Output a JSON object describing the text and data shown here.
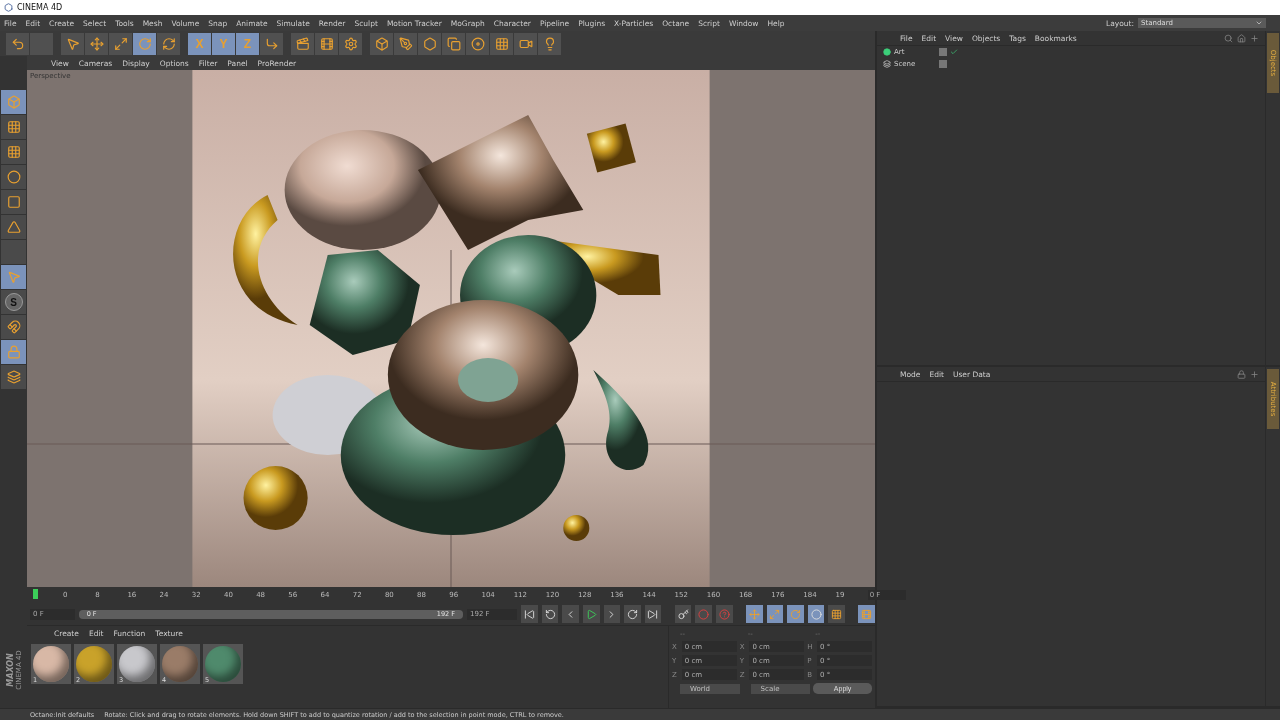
{
  "window": {
    "title": "CINEMA 4D"
  },
  "menu": [
    "File",
    "Edit",
    "Create",
    "Select",
    "Tools",
    "Mesh",
    "Volume",
    "Snap",
    "Animate",
    "Simulate",
    "Render",
    "Sculpt",
    "Motion Tracker",
    "MoGraph",
    "Character",
    "Pipeline",
    "Plugins",
    "X-Particles",
    "Octane",
    "Script",
    "Window",
    "Help"
  ],
  "layout": {
    "label": "Layout:",
    "value": "Standard"
  },
  "toolbar": [
    {
      "kind": "undo",
      "selected": false
    },
    {
      "kind": "blank",
      "selected": false
    },
    {
      "kind": "select",
      "selected": false
    },
    {
      "kind": "move",
      "selected": false
    },
    {
      "kind": "scale",
      "selected": false
    },
    {
      "kind": "rotate",
      "selected": true
    },
    {
      "kind": "recent",
      "selected": false
    },
    {
      "kind": "axis",
      "label": "X",
      "selected": true
    },
    {
      "kind": "axis",
      "label": "Y",
      "selected": true
    },
    {
      "kind": "axis",
      "label": "Z",
      "selected": true
    },
    {
      "kind": "coords",
      "selected": false
    },
    {
      "kind": "render-view",
      "selected": false
    },
    {
      "kind": "render",
      "selected": false
    },
    {
      "kind": "render-settings",
      "selected": false
    },
    {
      "kind": "cube",
      "selected": false
    },
    {
      "kind": "pen",
      "selected": false
    },
    {
      "kind": "subdivision",
      "selected": false
    },
    {
      "kind": "cloner",
      "selected": false
    },
    {
      "kind": "deformer",
      "selected": false
    },
    {
      "kind": "floor",
      "selected": false
    },
    {
      "kind": "camera",
      "selected": false
    },
    {
      "kind": "light",
      "selected": false
    }
  ],
  "left_tools": [
    {
      "kind": "model",
      "selected": true
    },
    {
      "kind": "texture",
      "selected": false
    },
    {
      "kind": "workplane",
      "selected": false
    },
    {
      "kind": "points",
      "selected": false
    },
    {
      "kind": "edges",
      "selected": false
    },
    {
      "kind": "polygons",
      "selected": false
    },
    {
      "kind": "axis",
      "selected": false
    },
    {
      "kind": "tweak",
      "selected": true
    },
    {
      "kind": "snap",
      "label": "S",
      "selected": false
    },
    {
      "kind": "magnet",
      "selected": false
    },
    {
      "kind": "lock-grid",
      "selected": true
    },
    {
      "kind": "grid",
      "selected": false
    }
  ],
  "viewport": {
    "menu": [
      "View",
      "Cameras",
      "Display",
      "Options",
      "Filter",
      "Panel",
      "ProRender"
    ],
    "camera": "Perspective"
  },
  "timeline": {
    "ticks": [
      "0",
      "8",
      "16",
      "24",
      "32",
      "40",
      "48",
      "56",
      "64",
      "72",
      "80",
      "88",
      "96",
      "104",
      "112",
      "120",
      "128",
      "136",
      "144",
      "152",
      "160",
      "168",
      "176",
      "184",
      "19"
    ],
    "current": "0 F",
    "start": "0 F",
    "range_start": "0 F",
    "range_end": "192 F",
    "range": {
      "level": 1
    },
    "end": "192 F"
  },
  "materials": {
    "menu": [
      "Create",
      "Edit",
      "Function",
      "Texture"
    ],
    "items": [
      {
        "label": "1",
        "color": "#d8b8a6"
      },
      {
        "label": "2",
        "color": "#c9a22a"
      },
      {
        "label": "3",
        "color": "#c8c8cc"
      },
      {
        "label": "4",
        "color": "#9a7c68"
      },
      {
        "label": "5",
        "color": "#4f8a6c"
      }
    ]
  },
  "coordinates": {
    "headers": [
      "--",
      "--",
      "--"
    ],
    "rows": [
      {
        "axis": "X",
        "position": "0 cm",
        "size_axis": "X",
        "size": "0 cm",
        "rot_axis": "H",
        "rotation": "0 °"
      },
      {
        "axis": "Y",
        "position": "0 cm",
        "size_axis": "Y",
        "size": "0 cm",
        "rot_axis": "P",
        "rotation": "0 °"
      },
      {
        "axis": "Z",
        "position": "0 cm",
        "size_axis": "Z",
        "size": "0 cm",
        "rot_axis": "B",
        "rotation": "0 °"
      }
    ],
    "dropdowns": [
      "World",
      "Scale"
    ],
    "apply": "Apply"
  },
  "logo": {
    "brand": "MAXON",
    "product": "CINEMA 4D"
  },
  "objects": {
    "menu": [
      "File",
      "Edit",
      "View",
      "Objects",
      "Tags",
      "Bookmarks"
    ],
    "items": [
      {
        "name": "Art",
        "kind": "null",
        "checked": true
      },
      {
        "name": "Scene",
        "kind": "layer",
        "checked": false
      }
    ],
    "tab": {
      "label": "Objects",
      "selected": true
    }
  },
  "attributes": {
    "menu": [
      "Mode",
      "Edit",
      "User Data"
    ],
    "tab": {
      "label": "Attributes",
      "selected": true
    }
  },
  "status_bar": [
    "Octane:Init defaults",
    "Rotate: Click and drag to rotate elements. Hold down SHIFT to add to quantize rotation / add to the selection in point mode, CTRL to remove."
  ]
}
